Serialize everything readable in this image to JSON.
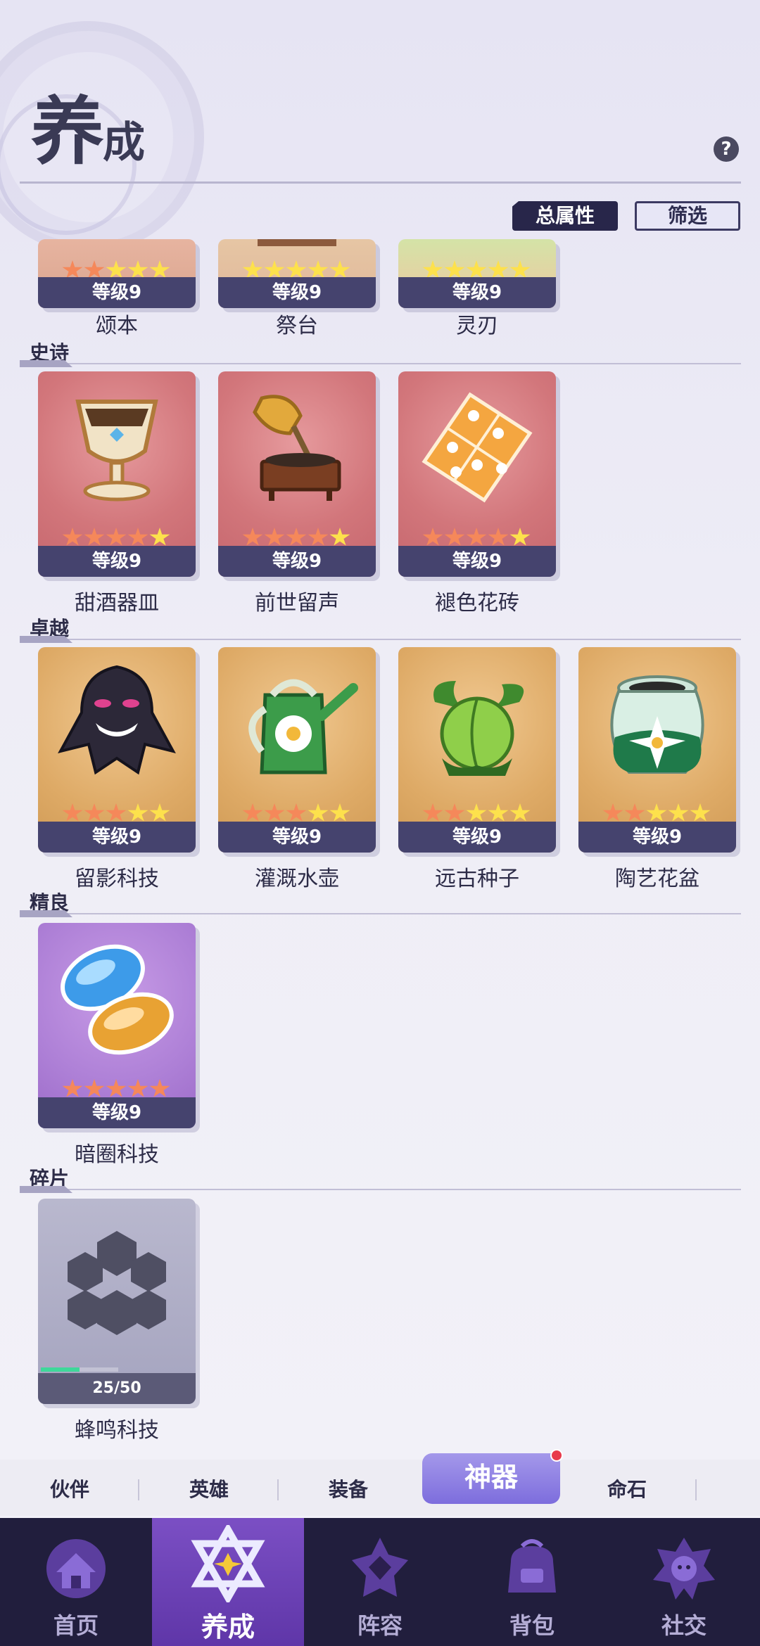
{
  "header": {
    "title_main": "养",
    "title_sub": "成",
    "help_label": "?",
    "total_attr_label": "总属性",
    "filter_label": "筛选"
  },
  "sections": {
    "top": {
      "items": [
        {
          "name": "颂本",
          "level": "等级9",
          "stars_orange": 2
        },
        {
          "name": "祭台",
          "level": "等级9",
          "stars_orange": 0
        },
        {
          "name": "灵刃",
          "level": "等级9",
          "stars_orange": 0
        }
      ]
    },
    "epic": {
      "label": "史诗",
      "items": [
        {
          "name": "甜酒器皿",
          "level": "等级9",
          "stars_orange": 4
        },
        {
          "name": "前世留声",
          "level": "等级9",
          "stars_orange": 4
        },
        {
          "name": "褪色花砖",
          "level": "等级9",
          "stars_orange": 4
        }
      ]
    },
    "superb": {
      "label": "卓越",
      "items": [
        {
          "name": "留影科技",
          "level": "等级9",
          "stars_orange": 3
        },
        {
          "name": "灌溉水壶",
          "level": "等级9",
          "stars_orange": 3
        },
        {
          "name": "远古种子",
          "level": "等级9",
          "stars_orange": 2
        },
        {
          "name": "陶艺花盆",
          "level": "等级9",
          "stars_orange": 2
        }
      ]
    },
    "fine": {
      "label": "精良",
      "items": [
        {
          "name": "暗圈科技",
          "level": "等级9",
          "stars_orange": 5
        }
      ]
    },
    "shard": {
      "label": "碎片",
      "items": [
        {
          "name": "蜂鸣科技",
          "progress": "25/50",
          "progress_fraction": 0.5
        }
      ]
    }
  },
  "subtabs": [
    "伙伴",
    "英雄",
    "装备",
    "神器",
    "命石"
  ],
  "active_subtab": "神器",
  "bottom_nav": [
    "首页",
    "养成",
    "阵容",
    "背包",
    "社交"
  ],
  "colors": {
    "accent": "#7d6ddd",
    "nav_bg": "#211e3d",
    "star_orange": "#f5885a",
    "star_yellow": "#fde14c"
  }
}
